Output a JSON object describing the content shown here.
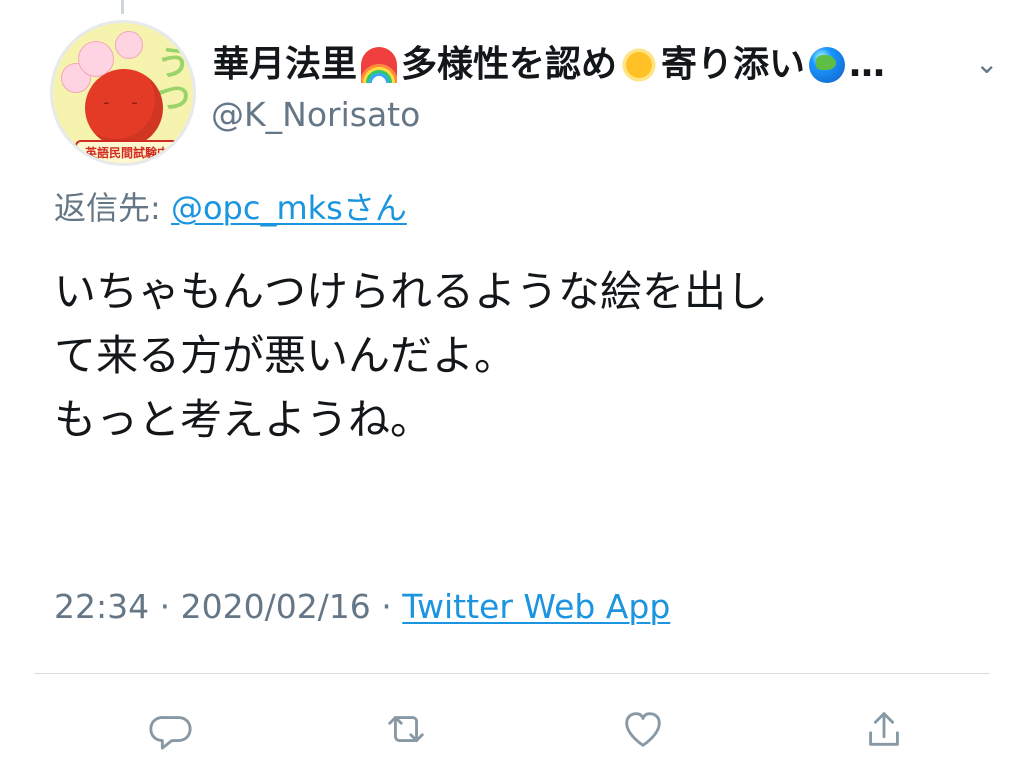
{
  "user": {
    "display_name_parts": [
      "華月法里",
      "多様性を認め",
      "寄り添い",
      "…"
    ],
    "handle": "@K_Norisato",
    "avatar_badge": "英語民間試験中止!"
  },
  "reply": {
    "prefix": "返信先: ",
    "target": "@opc_mksさん"
  },
  "tweet": {
    "text": "いちゃもんつけられるような絵を出し\nて来る方が悪いんだよ。\nもっと考えようね。"
  },
  "meta": {
    "time": "22:34",
    "separator1": " · ",
    "date": "2020/02/16",
    "separator2": " · ",
    "source": "Twitter Web App"
  },
  "icons": {
    "chevron": "chevron-down-icon",
    "reply": "reply-icon",
    "retweet": "retweet-icon",
    "like": "heart-icon",
    "share": "share-icon"
  },
  "colors": {
    "text": "#14171a",
    "secondary": "#657786",
    "link": "#1b95e0",
    "divider": "#d7dbe0"
  }
}
